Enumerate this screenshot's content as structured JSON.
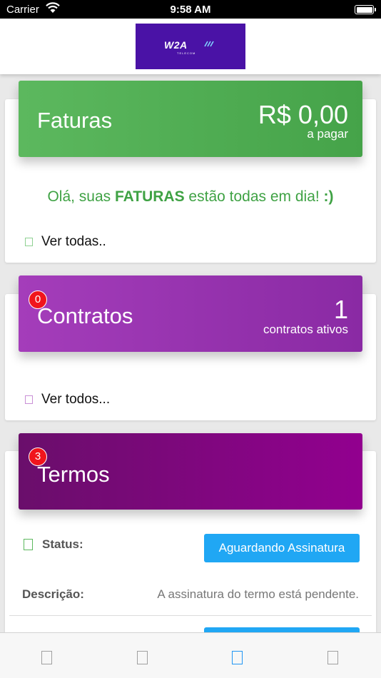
{
  "status_bar": {
    "carrier": "Carrier",
    "time": "9:58 AM"
  },
  "header": {
    "logo_word": "W2A",
    "logo_sub": "TELECOM"
  },
  "faturas": {
    "title": "Faturas",
    "amount": "R$ 0,00",
    "amount_label": "a pagar",
    "message_prefix": "Olá, suas ",
    "message_bold": "FATURAS",
    "message_suffix": " estão todas em dia! ",
    "message_emoticon": ":)",
    "link": "Ver todas.."
  },
  "contratos": {
    "title": "Contratos",
    "badge": "0",
    "count": "1",
    "count_label": "contratos ativos",
    "link": "Ver todos..."
  },
  "termos": {
    "title": "Termos",
    "badge": "3",
    "status_label": "Status:",
    "status_value": "Aguardando Assinatura",
    "description_label": "Descrição:",
    "description_value": "A assinatura do termo está pendente."
  },
  "tabbar": {
    "active_index": 2,
    "tabs": [
      "tab-1",
      "tab-2",
      "tab-3",
      "tab-4"
    ]
  },
  "colors": {
    "faturas": "#4caf50",
    "contratos": "#9c37b4",
    "termos": "#7b0a7c",
    "status_button": "#20a7f4",
    "badge": "#f0151c",
    "logo_bg": "#4a12a6"
  }
}
